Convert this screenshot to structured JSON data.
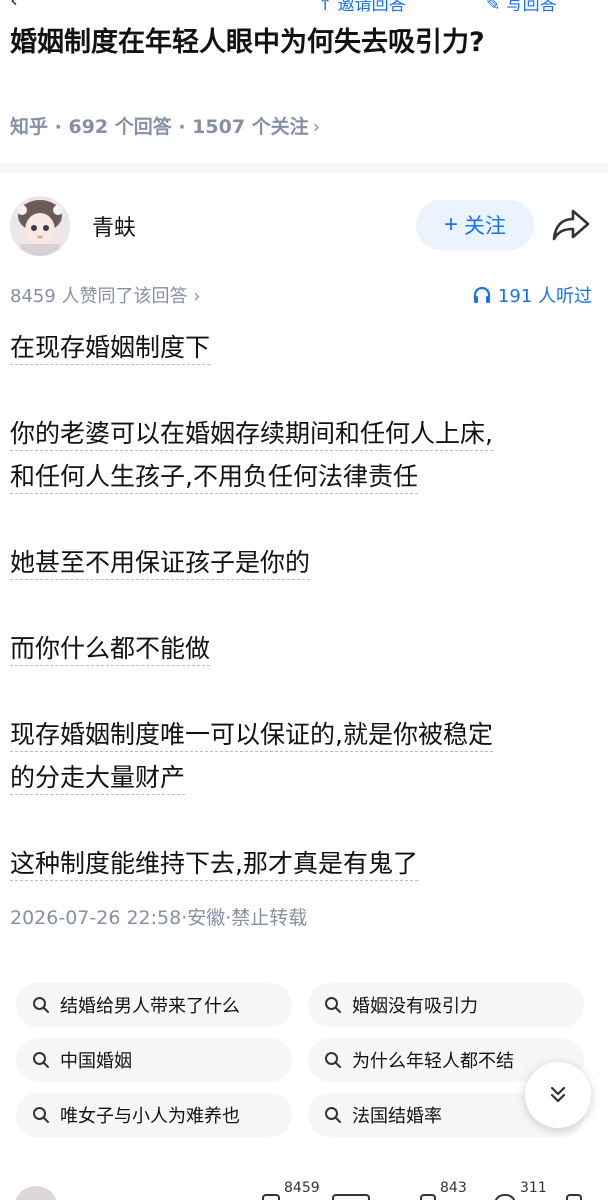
{
  "topbar": {
    "back_glyph": "‹",
    "invite_label": "↑ 邀请回答",
    "write_label": "✎ 写回答"
  },
  "question": {
    "title": "婚姻制度在年轻人眼中为何失去吸引力?",
    "meta": "知乎 · 692 个回答 · 1507 个关注",
    "meta_chevron": "›"
  },
  "answer": {
    "author": "青蚨",
    "follow_label": "关注",
    "follow_plus": "+",
    "likes_line": "8459 人赞同了该回答 ›",
    "listen_label": "191 人听过",
    "paragraphs": [
      [
        "在现存婚姻制度下"
      ],
      [
        "你的老婆可以在婚姻存续期间和任何人上床,",
        "和任何人生孩子,不用负任何法律责任"
      ],
      [
        "她甚至不用保证孩子是你的"
      ],
      [
        "而你什么都不能做"
      ],
      [
        "现存婚姻制度唯一可以保证的,就是你被稳定",
        "的分走大量财产"
      ],
      [
        "这种制度能维持下去,那才真是有鬼了"
      ]
    ],
    "timestamp": "2026-07-26 22:58·安徽·禁止转载"
  },
  "related_searches": [
    "结婚给男人带来了什么",
    "婚姻没有吸引力",
    "中国婚姻",
    "为什么年轻人都不结",
    "唯女子与小人为难养也",
    "法国结婚率"
  ],
  "bottombar": {
    "like_count": "8459",
    "comment_count": "843",
    "favorite_count": "311"
  },
  "icons": {
    "back": "chevron-left-icon",
    "share": "share-arrow-icon",
    "listen": "headphones-icon",
    "search": "magnifier-icon",
    "scroll": "double-chevron-down-icon"
  },
  "colors": {
    "accent": "#1772f6",
    "follow_bg": "#ebf3ff",
    "muted_text": "#8590a6",
    "chip_bg": "#f6f6f6",
    "text": "#121212"
  }
}
